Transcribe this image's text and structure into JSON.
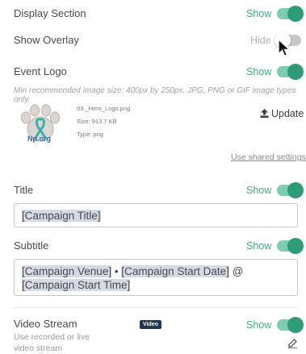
{
  "display_section": {
    "label": "Display Section",
    "state": "Show"
  },
  "show_overlay": {
    "label": "Show Overlay",
    "state": "Hide"
  },
  "event_logo": {
    "label": "Event Logo",
    "state": "Show",
    "hint": "Min recommended image size: 400px by 250px. JPG, PNG or GIF image types only.",
    "file_name": "03._Hero_Logo.png",
    "file_size": "Size: 913.7 KB",
    "file_type": "Type: png",
    "logo_text": "Np.org",
    "update_label": "Update",
    "shared_settings_label": "Use shared settings"
  },
  "title": {
    "label": "Title",
    "state": "Show",
    "value": "[Campaign Title]"
  },
  "subtitle": {
    "label": "Subtitle",
    "state": "Show",
    "value_parts": [
      "[Campaign Venue]",
      " • ",
      "[Campaign Start Date]",
      " @ ",
      "[Campaign Start Time]"
    ]
  },
  "video_stream": {
    "label": "Video Stream",
    "badge": "Video",
    "state": "Show",
    "description": "Use recorded or live video stream"
  },
  "colors": {
    "accent": "#2e9c78",
    "accent_light": "#7ccdb0",
    "badge": "#1f3554"
  }
}
